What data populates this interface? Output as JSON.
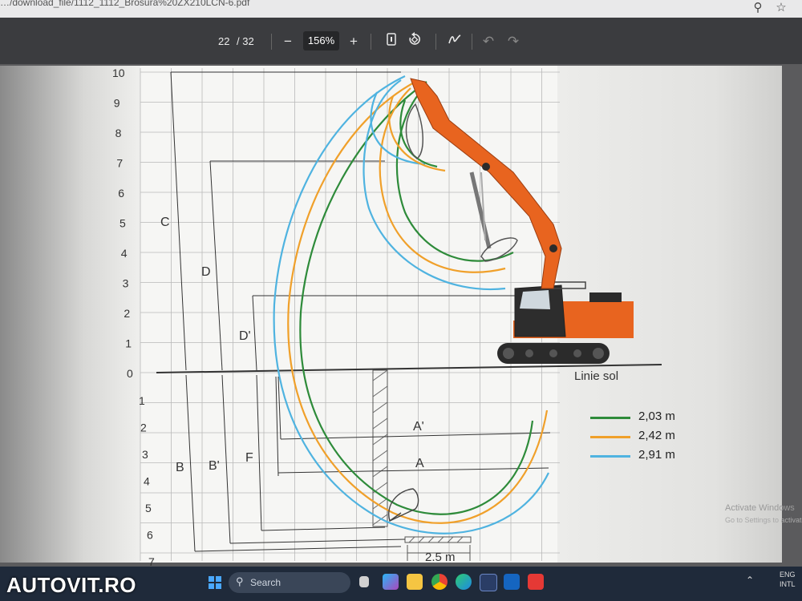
{
  "browser": {
    "url": "…/download_file/1112_1112_Brosura%20ZX210LCN-6.pdf",
    "zoom_icon": "zoom-icon",
    "star_icon": "star-icon"
  },
  "pdf_toolbar": {
    "current_page": "22",
    "page_total": "/ 32",
    "zoom_minus": "−",
    "zoom_value": "156%",
    "zoom_plus": "+",
    "undo": "↶",
    "redo": "↷"
  },
  "diagram": {
    "upper_ticks": [
      "10",
      "9",
      "8",
      "7",
      "6",
      "5",
      "4",
      "3",
      "2",
      "1",
      "0"
    ],
    "lower_ticks": [
      "1",
      "2",
      "3",
      "4",
      "5",
      "6",
      "7"
    ],
    "dimension_labels": {
      "C": "C",
      "D": "D",
      "D_prime": "D'",
      "B": "B",
      "B_prime": "B'",
      "F": "F",
      "A": "A",
      "A_prime": "A'"
    },
    "ground_label": "Linie sol",
    "width_label": "2.5 m",
    "colors": {
      "green": "#2e8b3a",
      "orange": "#f0a02a",
      "blue": "#4fb3e0",
      "machine": "#e8641f"
    }
  },
  "legend": [
    {
      "label": "2,03 m",
      "color": "#2e8b3a"
    },
    {
      "label": "2,42 m",
      "color": "#f0a02a"
    },
    {
      "label": "2,91 m",
      "color": "#4fb3e0"
    }
  ],
  "windows_notice": {
    "line1": "Activate Windows",
    "line2": "Go to Settings to activate"
  },
  "taskbar": {
    "search_placeholder": "Search",
    "lang": "ENG",
    "layout": "INTL"
  },
  "watermark": "AUTOVIT.RO"
}
